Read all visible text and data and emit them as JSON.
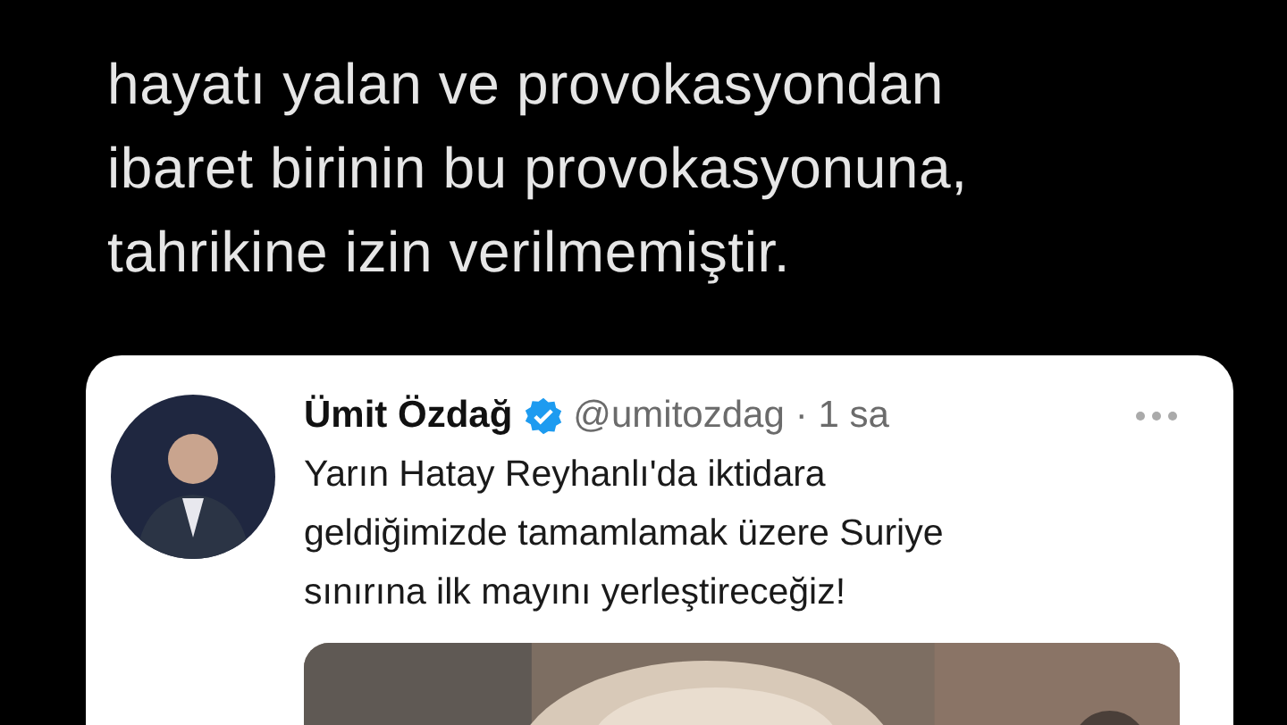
{
  "tweet": {
    "text": "hayatı yalan ve provokasyondan\nibaret birinin bu provokasyonuna,\ntahrikine izin verilmemiştir."
  },
  "quoted_tweet": {
    "name": "Ümit Özdağ",
    "verified": true,
    "handle": "@umitozdag",
    "time": "· 1 sa",
    "text": "Yarın Hatay Reyhanlı'da iktidara\ngeldiğimizde tamamlamak üzere Suriye\nsınırına ilk mayını yerleştireceğiz!"
  }
}
